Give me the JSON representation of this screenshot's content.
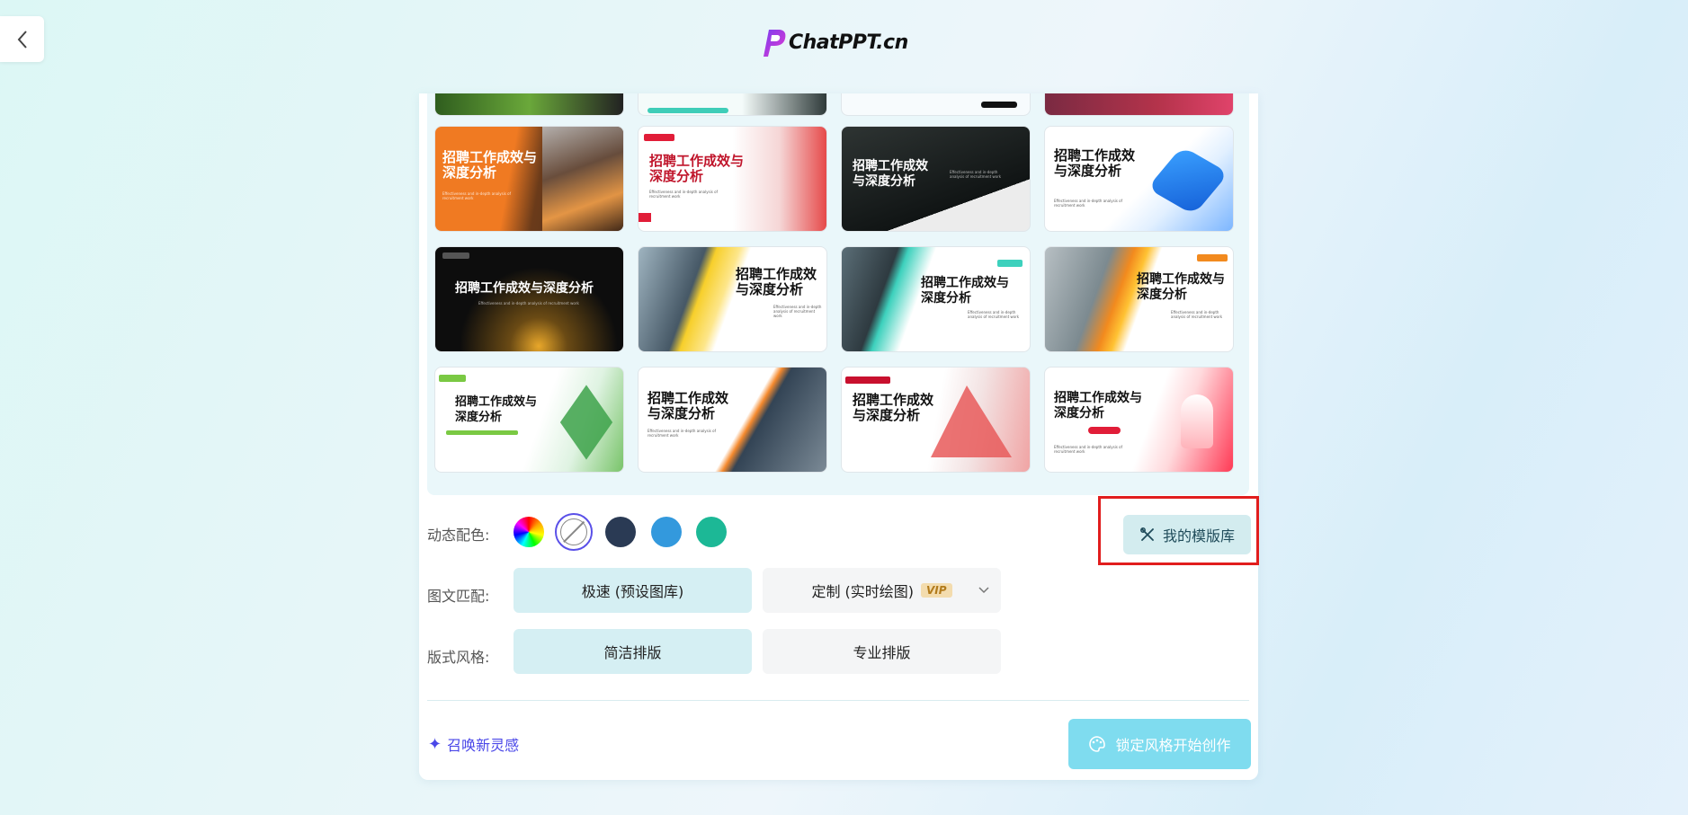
{
  "logo": {
    "brand": "ChatPPT.cn"
  },
  "template_title": "招聘工作成效与深度分析",
  "template_title_split": [
    "招聘工作成效",
    "与深度分析"
  ],
  "template_title_split2": [
    "招聘工作成效与",
    "深度分析"
  ],
  "template_subtitle": "Effectiveness and in-depth analysis of recruitment work",
  "color_row": {
    "label": "动态配色:",
    "swatches": [
      {
        "name": "rainbow",
        "color": "conic"
      },
      {
        "name": "none",
        "color": "#ffffff"
      },
      {
        "name": "navy",
        "color": "#2a3a54"
      },
      {
        "name": "blue",
        "color": "#3399dd"
      },
      {
        "name": "teal",
        "color": "#1cb896"
      }
    ],
    "selected": "none"
  },
  "my_library_label": "我的模版库",
  "image_match": {
    "label": "图文匹配:",
    "options": [
      "极速 (预设图库)",
      "定制 (实时绘图)"
    ],
    "vip": "VIP",
    "selected": 0
  },
  "layout_style": {
    "label": "版式风格:",
    "options": [
      "简洁排版",
      "专业排版"
    ],
    "selected": 0
  },
  "inspire_label": "召唤新灵感",
  "start_label": "锁定风格开始创作",
  "colors": {
    "accent": "#4a47e8",
    "primary_btn": "#7fdcef",
    "highlight": "#e11d1d"
  }
}
